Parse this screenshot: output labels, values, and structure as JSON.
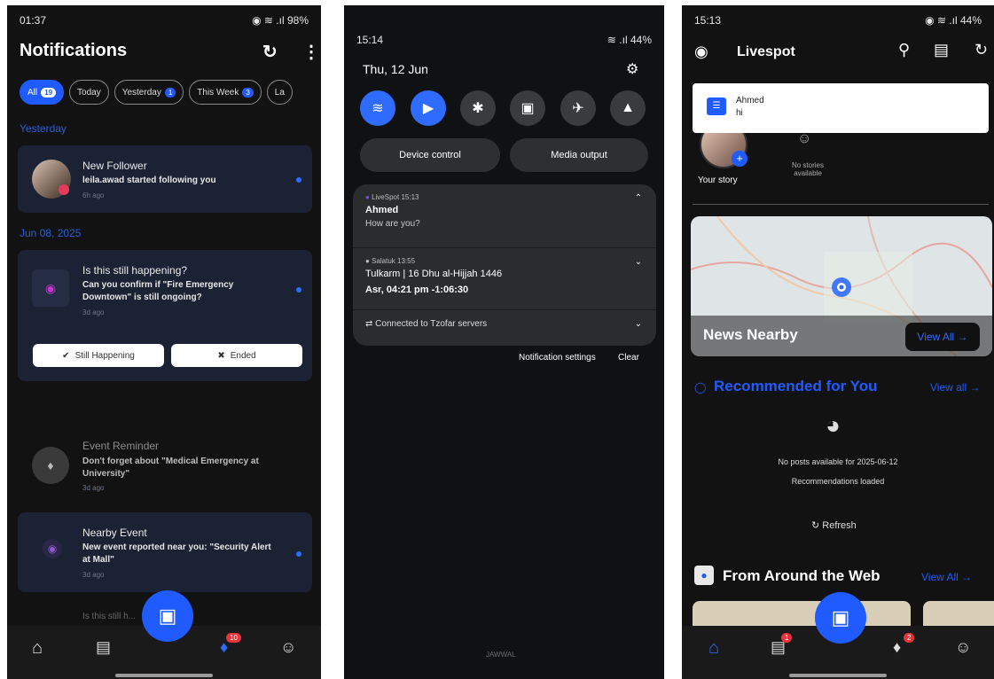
{
  "phone1": {
    "status": {
      "time": "01:37",
      "battery": "98%"
    },
    "title": "Notifications",
    "chips": [
      {
        "label": "All",
        "count": "19"
      },
      {
        "label": "Today",
        "count": ""
      },
      {
        "label": "Yesterday",
        "count": "1"
      },
      {
        "label": "This Week",
        "count": "3"
      },
      {
        "label": "La",
        "count": ""
      }
    ],
    "sections": {
      "yesterday": "Yesterday",
      "jun08": "Jun 08, 2025"
    },
    "notifications": [
      {
        "title": "New Follower",
        "body": "leila.awad started following you",
        "ago": "6h ago"
      },
      {
        "title": "Is this still happening?",
        "body": "Can you confirm if \"Fire Emergency Downtown\" is still ongoing?",
        "ago": "3d ago"
      },
      {
        "title": "Event Reminder",
        "body": "Don't forget about \"Medical Emergency at University\"",
        "ago": "3d ago"
      },
      {
        "title": "Nearby Event",
        "body": "New event reported near you: \"Security Alert at Mall\"",
        "ago": "3d ago"
      },
      {
        "title": "Is this still h...",
        "body": "",
        "ago": ""
      }
    ],
    "actions": {
      "still": "Still Happening",
      "ended": "Ended"
    },
    "nav_badge": "10"
  },
  "phone2": {
    "status": {
      "time": "15:14",
      "battery": "44%"
    },
    "date": "Thu, 12 Jun",
    "pills": {
      "device": "Device control",
      "media": "Media output"
    },
    "notif1": {
      "app": "LiveSpot",
      "time": "15:13",
      "title": "Ahmed",
      "body": "How are you?"
    },
    "notif2": {
      "app": "Salatuk",
      "time": "13:55",
      "line1": "Tulkarm  |  16 Dhu al-Hijjah 1446",
      "line2": "Asr, 04:21 pm  -1:06:30"
    },
    "notif3": {
      "text": "Connected to Tzofar servers"
    },
    "footer": {
      "settings": "Notification settings",
      "clear": "Clear"
    },
    "carrier": "JAWWAL"
  },
  "phone3": {
    "status": {
      "time": "15:13",
      "battery": "44%"
    },
    "title": "Livespot",
    "toast": {
      "name": "Ahmed",
      "msg": "hi"
    },
    "story": {
      "your": "Your story",
      "none": "No stories available"
    },
    "news": {
      "title": "News Nearby",
      "viewall": "View All →"
    },
    "recommended": {
      "title": "Recommended for You",
      "viewall": "View all →",
      "empty": "No posts available for 2025-06-12",
      "loaded": "Recommendations loaded",
      "refresh": "Refresh"
    },
    "web": {
      "title": "From Around the Web",
      "viewall": "View All →"
    },
    "badges": {
      "chat": "1",
      "bell": "2"
    }
  }
}
